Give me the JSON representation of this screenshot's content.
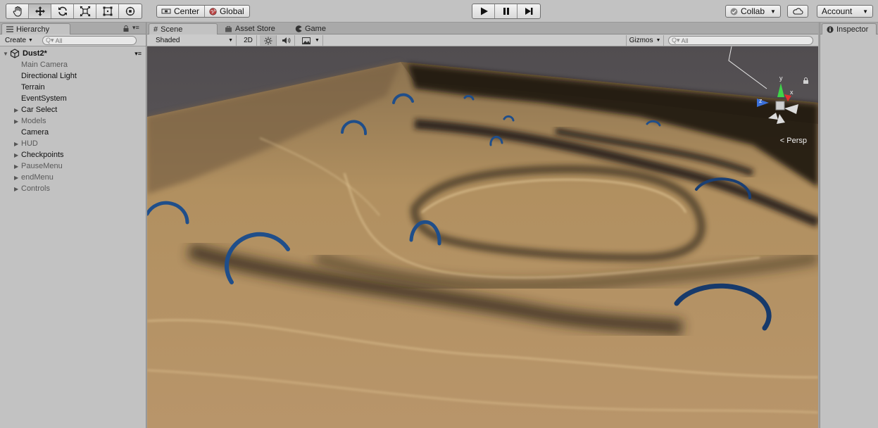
{
  "toolbar": {
    "tools": [
      {
        "name": "hand-tool",
        "icon": "hand-icon"
      },
      {
        "name": "move-tool",
        "icon": "move-arrows-icon",
        "active": true
      },
      {
        "name": "rotate-tool",
        "icon": "rotate-icon"
      },
      {
        "name": "scale-tool",
        "icon": "scale-icon"
      },
      {
        "name": "rect-tool",
        "icon": "rect-icon"
      },
      {
        "name": "transform-tool",
        "icon": "transform-icon"
      }
    ],
    "pivot_label": "Center",
    "rotation_label": "Global",
    "collab_label": "Collab",
    "account_label": "Account"
  },
  "hierarchy": {
    "tab_label": "Hierarchy",
    "create_label": "Create",
    "search_placeholder": "All",
    "scene_name": "Dust2*",
    "items": [
      {
        "label": "Main Camera",
        "expandable": false,
        "inactive": true
      },
      {
        "label": "Directional Light",
        "expandable": false,
        "inactive": false
      },
      {
        "label": "Terrain",
        "expandable": false,
        "inactive": false
      },
      {
        "label": "EventSystem",
        "expandable": false,
        "inactive": false
      },
      {
        "label": "Car Select",
        "expandable": true,
        "inactive": false
      },
      {
        "label": "Models",
        "expandable": true,
        "inactive": true
      },
      {
        "label": "Camera",
        "expandable": false,
        "inactive": false
      },
      {
        "label": "HUD",
        "expandable": true,
        "inactive": true
      },
      {
        "label": "Checkpoints",
        "expandable": true,
        "inactive": false
      },
      {
        "label": "PauseMenu",
        "expandable": true,
        "inactive": true
      },
      {
        "label": "endMenu",
        "expandable": true,
        "inactive": true
      },
      {
        "label": "Controls",
        "expandable": true,
        "inactive": true
      }
    ]
  },
  "scene": {
    "tabs": [
      "Scene",
      "Asset Store",
      "Game"
    ],
    "shading_mode": "Shaded",
    "mode_2d": "2D",
    "gizmos_label": "Gizmos",
    "search_placeholder": "All",
    "projection_label": "Persp",
    "gizmo_axes": {
      "x": "x",
      "y": "y",
      "z": "z"
    }
  },
  "inspector": {
    "tab_label": "Inspector"
  },
  "colors": {
    "sand": "#b69460",
    "sky": "#5e5a5c",
    "ring": "#1f4e8a"
  }
}
